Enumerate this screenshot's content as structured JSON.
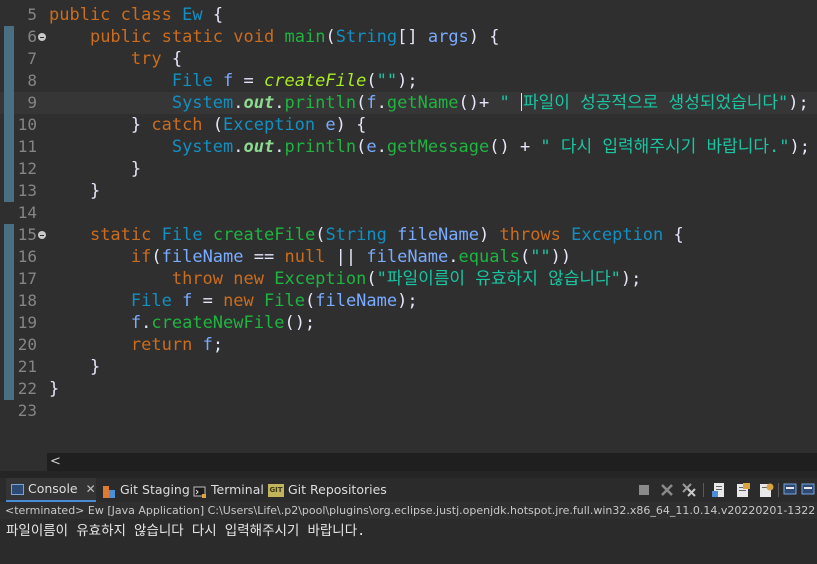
{
  "editor": {
    "lines": [
      {
        "num": "5",
        "fold": false,
        "current": false,
        "tokens": [
          [
            "kw",
            "public"
          ],
          [
            "op",
            " "
          ],
          [
            "kw",
            "class"
          ],
          [
            "op",
            " "
          ],
          [
            "ty",
            "Ew"
          ],
          [
            "op",
            " {"
          ]
        ]
      },
      {
        "num": "6",
        "fold": true,
        "current": false,
        "tokens": [
          [
            "op",
            "    "
          ],
          [
            "kw",
            "public"
          ],
          [
            "op",
            " "
          ],
          [
            "kw",
            "static"
          ],
          [
            "op",
            " "
          ],
          [
            "kw",
            "void"
          ],
          [
            "op",
            " "
          ],
          [
            "me",
            "main"
          ],
          [
            "op",
            "("
          ],
          [
            "ty",
            "String"
          ],
          [
            "op",
            "[] "
          ],
          [
            "va",
            "args"
          ],
          [
            "op",
            ") {"
          ]
        ]
      },
      {
        "num": "7",
        "fold": false,
        "current": false,
        "tokens": [
          [
            "op",
            "        "
          ],
          [
            "kw",
            "try"
          ],
          [
            "op",
            " {"
          ]
        ]
      },
      {
        "num": "8",
        "fold": false,
        "current": false,
        "tokens": [
          [
            "op",
            "            "
          ],
          [
            "ty",
            "File"
          ],
          [
            "op",
            " "
          ],
          [
            "va",
            "f"
          ],
          [
            "op",
            " = "
          ],
          [
            "mi",
            "createFile"
          ],
          [
            "op",
            "("
          ],
          [
            "st",
            "\"\""
          ],
          [
            "op",
            ");"
          ]
        ]
      },
      {
        "num": "9",
        "fold": false,
        "current": true,
        "tokens": [
          [
            "op",
            "            "
          ],
          [
            "ty",
            "System"
          ],
          [
            "op",
            "."
          ],
          [
            "fi",
            "out"
          ],
          [
            "op",
            "."
          ],
          [
            "me",
            "println"
          ],
          [
            "op",
            "("
          ],
          [
            "va",
            "f"
          ],
          [
            "op",
            "."
          ],
          [
            "me",
            "getName"
          ],
          [
            "op",
            "()+ "
          ],
          [
            "st",
            "\" "
          ],
          [
            "caret",
            ""
          ],
          [
            "st",
            "파일이 성공적으로 생성되었습니다\""
          ],
          [
            "op",
            ");"
          ]
        ]
      },
      {
        "num": "10",
        "fold": false,
        "current": false,
        "tokens": [
          [
            "op",
            "        } "
          ],
          [
            "kw",
            "catch"
          ],
          [
            "op",
            " ("
          ],
          [
            "ty",
            "Exception"
          ],
          [
            "op",
            " "
          ],
          [
            "va",
            "e"
          ],
          [
            "op",
            ") {"
          ]
        ]
      },
      {
        "num": "11",
        "fold": false,
        "current": false,
        "tokens": [
          [
            "op",
            "            "
          ],
          [
            "ty",
            "System"
          ],
          [
            "op",
            "."
          ],
          [
            "fi",
            "out"
          ],
          [
            "op",
            "."
          ],
          [
            "me",
            "println"
          ],
          [
            "op",
            "("
          ],
          [
            "va",
            "e"
          ],
          [
            "op",
            "."
          ],
          [
            "me",
            "getMessage"
          ],
          [
            "op",
            "() + "
          ],
          [
            "st",
            "\" 다시 입력해주시기 바랍니다.\""
          ],
          [
            "op",
            ");"
          ]
        ]
      },
      {
        "num": "12",
        "fold": false,
        "current": false,
        "tokens": [
          [
            "op",
            "        }"
          ]
        ]
      },
      {
        "num": "13",
        "fold": false,
        "current": false,
        "tokens": [
          [
            "op",
            "    }"
          ]
        ]
      },
      {
        "num": "14",
        "fold": false,
        "current": false,
        "tokens": []
      },
      {
        "num": "15",
        "fold": true,
        "current": false,
        "tokens": [
          [
            "op",
            "    "
          ],
          [
            "kw",
            "static"
          ],
          [
            "op",
            " "
          ],
          [
            "ty",
            "File"
          ],
          [
            "op",
            " "
          ],
          [
            "me",
            "createFile"
          ],
          [
            "op",
            "("
          ],
          [
            "ty",
            "String"
          ],
          [
            "op",
            " "
          ],
          [
            "va",
            "fileName"
          ],
          [
            "op",
            ") "
          ],
          [
            "kw",
            "throws"
          ],
          [
            "op",
            " "
          ],
          [
            "ty",
            "Exception"
          ],
          [
            "op",
            " {"
          ]
        ]
      },
      {
        "num": "16",
        "fold": false,
        "current": false,
        "tokens": [
          [
            "op",
            "        "
          ],
          [
            "kw",
            "if"
          ],
          [
            "op",
            "("
          ],
          [
            "va",
            "fileName"
          ],
          [
            "op",
            " == "
          ],
          [
            "kw",
            "null"
          ],
          [
            "op",
            " || "
          ],
          [
            "va",
            "fileName"
          ],
          [
            "op",
            "."
          ],
          [
            "me",
            "equals"
          ],
          [
            "op",
            "("
          ],
          [
            "st",
            "\"\""
          ],
          [
            "op",
            "))"
          ]
        ]
      },
      {
        "num": "17",
        "fold": false,
        "current": false,
        "tokens": [
          [
            "op",
            "            "
          ],
          [
            "kw",
            "throw"
          ],
          [
            "op",
            " "
          ],
          [
            "kw",
            "new"
          ],
          [
            "op",
            " "
          ],
          [
            "me",
            "Exception"
          ],
          [
            "op",
            "("
          ],
          [
            "st",
            "\"파일이름이 유효하지 않습니다\""
          ],
          [
            "op",
            ");"
          ]
        ]
      },
      {
        "num": "18",
        "fold": false,
        "current": false,
        "tokens": [
          [
            "op",
            "        "
          ],
          [
            "ty",
            "File"
          ],
          [
            "op",
            " "
          ],
          [
            "va",
            "f"
          ],
          [
            "op",
            " = "
          ],
          [
            "kw",
            "new"
          ],
          [
            "op",
            " "
          ],
          [
            "me",
            "File"
          ],
          [
            "op",
            "("
          ],
          [
            "va",
            "fileName"
          ],
          [
            "op",
            ");"
          ]
        ]
      },
      {
        "num": "19",
        "fold": false,
        "current": false,
        "tokens": [
          [
            "op",
            "        "
          ],
          [
            "va",
            "f"
          ],
          [
            "op",
            "."
          ],
          [
            "me",
            "createNewFile"
          ],
          [
            "op",
            "();"
          ]
        ]
      },
      {
        "num": "20",
        "fold": false,
        "current": false,
        "tokens": [
          [
            "op",
            "        "
          ],
          [
            "kw",
            "return"
          ],
          [
            "op",
            " "
          ],
          [
            "va",
            "f"
          ],
          [
            "op",
            ";"
          ]
        ]
      },
      {
        "num": "21",
        "fold": false,
        "current": false,
        "tokens": [
          [
            "op",
            "    }"
          ]
        ]
      },
      {
        "num": "22",
        "fold": false,
        "current": false,
        "tokens": [
          [
            "op",
            "}"
          ]
        ]
      },
      {
        "num": "23",
        "fold": false,
        "current": false,
        "tokens": []
      }
    ]
  },
  "colors": {
    "keyword": "#cc6c1d",
    "type": "#1290c3",
    "method": "#1eb540",
    "static_method": "#a7ec21",
    "static_field": "#8dda90",
    "variable": "#79abff",
    "string": "#17c6a3",
    "background": "#2f2f2f",
    "active_tab_underline": "#4a8bd8"
  },
  "hscroll": {
    "left_arrow": "<"
  },
  "tabs": [
    {
      "label": "Console",
      "icon": "console-icon",
      "active": true
    },
    {
      "label": "Git Staging",
      "icon": "git-staging-icon",
      "active": false
    },
    {
      "label": "Terminal",
      "icon": "terminal-icon",
      "active": false
    },
    {
      "label": "Git Repositories",
      "icon": "git-repositories-icon",
      "active": false
    }
  ],
  "tab_close": "✕",
  "toolbar": [
    {
      "name": "terminate-icon"
    },
    {
      "name": "remove-launch-icon"
    },
    {
      "name": "remove-all-terminated-icon"
    },
    {
      "name": "scroll-lock-icon"
    },
    {
      "name": "clear-console-icon"
    },
    {
      "name": "pin-console-icon"
    },
    {
      "name": "display-selected-console-icon"
    },
    {
      "name": "open-console-icon"
    }
  ],
  "console": {
    "status": "<terminated> Ew [Java Application] C:\\Users\\Life\\.p2\\pool\\plugins\\org.eclipse.justj.openjdk.hotspot.jre.full.win32.x86_64_11.0.14.v20220201-1322",
    "output": "파일이름이 유효하지 않습니다 다시 입력해주시기 바랍니다."
  }
}
